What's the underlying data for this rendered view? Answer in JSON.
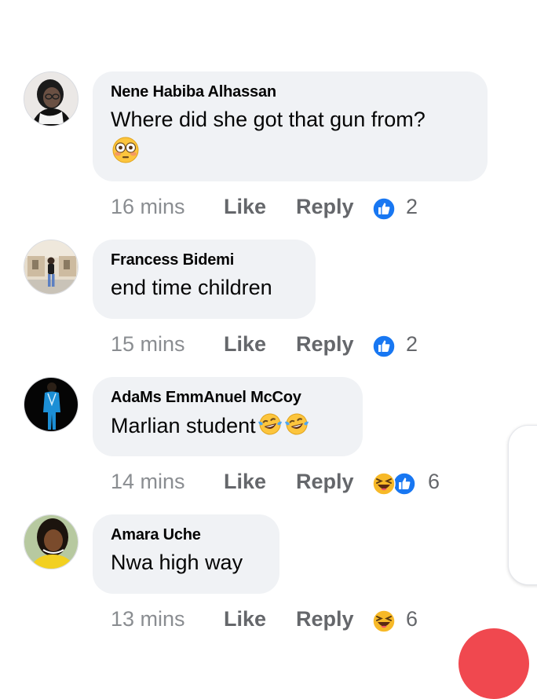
{
  "comments": [
    {
      "author": "Nene Habiba Alhassan",
      "text": "Where did she got that gun from?",
      "text_emoji": "flushed-face",
      "time": "16 mins",
      "like_label": "Like",
      "reply_label": "Reply",
      "reactions": [
        "like"
      ],
      "reaction_count": "2"
    },
    {
      "author": "Francess Bidemi",
      "text": "end time children",
      "time": "15 mins",
      "like_label": "Like",
      "reply_label": "Reply",
      "reactions": [
        "like"
      ],
      "reaction_count": "2"
    },
    {
      "author": "AdaMs EmmAnuel McCoy",
      "text": "Marlian student",
      "text_emoji": "face-with-tears-of-joy x2",
      "time": "14 mins",
      "like_label": "Like",
      "reply_label": "Reply",
      "reactions": [
        "haha",
        "like"
      ],
      "reaction_count": "6"
    },
    {
      "author": "Amara Uche",
      "text": "Nwa high way",
      "time": "13 mins",
      "like_label": "Like",
      "reply_label": "Reply",
      "reactions": [
        "haha"
      ],
      "reaction_count": "6"
    }
  ],
  "colors": {
    "bubble": "#f0f2f5",
    "meta_text": "#65676b",
    "like_blue": "#1877f2",
    "haha_yellow": "#f7b928",
    "fab_red": "#f0484f"
  }
}
